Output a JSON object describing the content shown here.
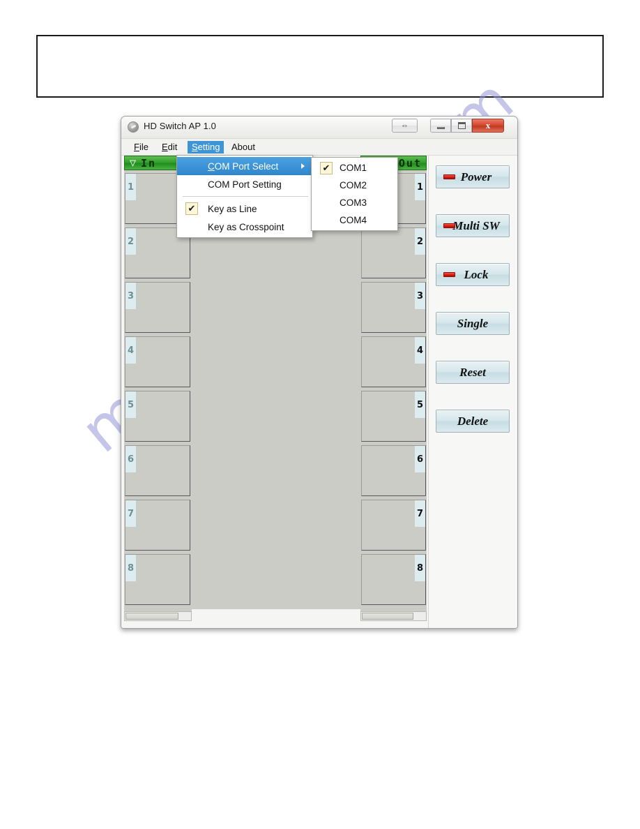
{
  "document": {
    "empty_box": ""
  },
  "watermark": {
    "text": "manualshive.com"
  },
  "window": {
    "title": "HD Switch AP 1.0",
    "icon": "app-globe-icon",
    "controls": {
      "resize": "⇔",
      "minimize": "minimize-icon",
      "maximize": "maximize-icon",
      "close": "x"
    }
  },
  "menubar": {
    "items": [
      {
        "label": "File",
        "accel": "F",
        "rest": "ile",
        "active": false
      },
      {
        "label": "Edit",
        "accel": "E",
        "rest": "dit",
        "active": false
      },
      {
        "label": "Setting",
        "accel": "S",
        "rest": "etting",
        "active": true
      },
      {
        "label": "About",
        "accel": "",
        "rest": "About",
        "active": false
      }
    ]
  },
  "setting_menu": {
    "items": [
      {
        "label": "COM Port Select",
        "accel": "C",
        "rest": "OM Port Select",
        "highlight": true,
        "has_submenu": true,
        "checked": false
      },
      {
        "label": "COM Port Setting",
        "accel": "",
        "rest": "COM Port Setting",
        "highlight": false,
        "has_submenu": false,
        "checked": false
      },
      {
        "separator": true
      },
      {
        "label": "Key as Line",
        "accel": "",
        "rest": "Key as Line",
        "highlight": false,
        "has_submenu": false,
        "checked": true
      },
      {
        "label": "Key as Crosspoint",
        "accel": "",
        "rest": "Key as Crosspoint",
        "highlight": false,
        "has_submenu": false,
        "checked": false
      }
    ]
  },
  "com_submenu": {
    "items": [
      {
        "label": "COM1",
        "checked": true
      },
      {
        "label": "COM2",
        "checked": false
      },
      {
        "label": "COM3",
        "checked": false
      },
      {
        "label": "COM4",
        "checked": false
      }
    ]
  },
  "matrix": {
    "input": {
      "header_label": "In",
      "header_caret": "▽",
      "rows": [
        "1",
        "2",
        "3",
        "4",
        "5",
        "6",
        "7",
        "8"
      ]
    },
    "output": {
      "header_label": "Out",
      "rows": [
        "1",
        "2",
        "3",
        "4",
        "5",
        "6",
        "7",
        "8"
      ]
    }
  },
  "actions": {
    "buttons": [
      {
        "label": "Power",
        "led": true
      },
      {
        "label": "Multi SW",
        "led": true
      },
      {
        "label": "Lock",
        "led": true
      },
      {
        "label": "Single",
        "led": false
      },
      {
        "label": "Reset",
        "led": false
      },
      {
        "label": "Delete",
        "led": false
      }
    ]
  },
  "colors": {
    "header_green": "#2f9e2a",
    "menu_highlight": "#3d95d8",
    "led_red": "#d2190f",
    "button_face": "#d5e6eb",
    "panel_gray": "#ccccc6",
    "row_number_bg": "#dcecef",
    "close_red": "#d8492f"
  }
}
